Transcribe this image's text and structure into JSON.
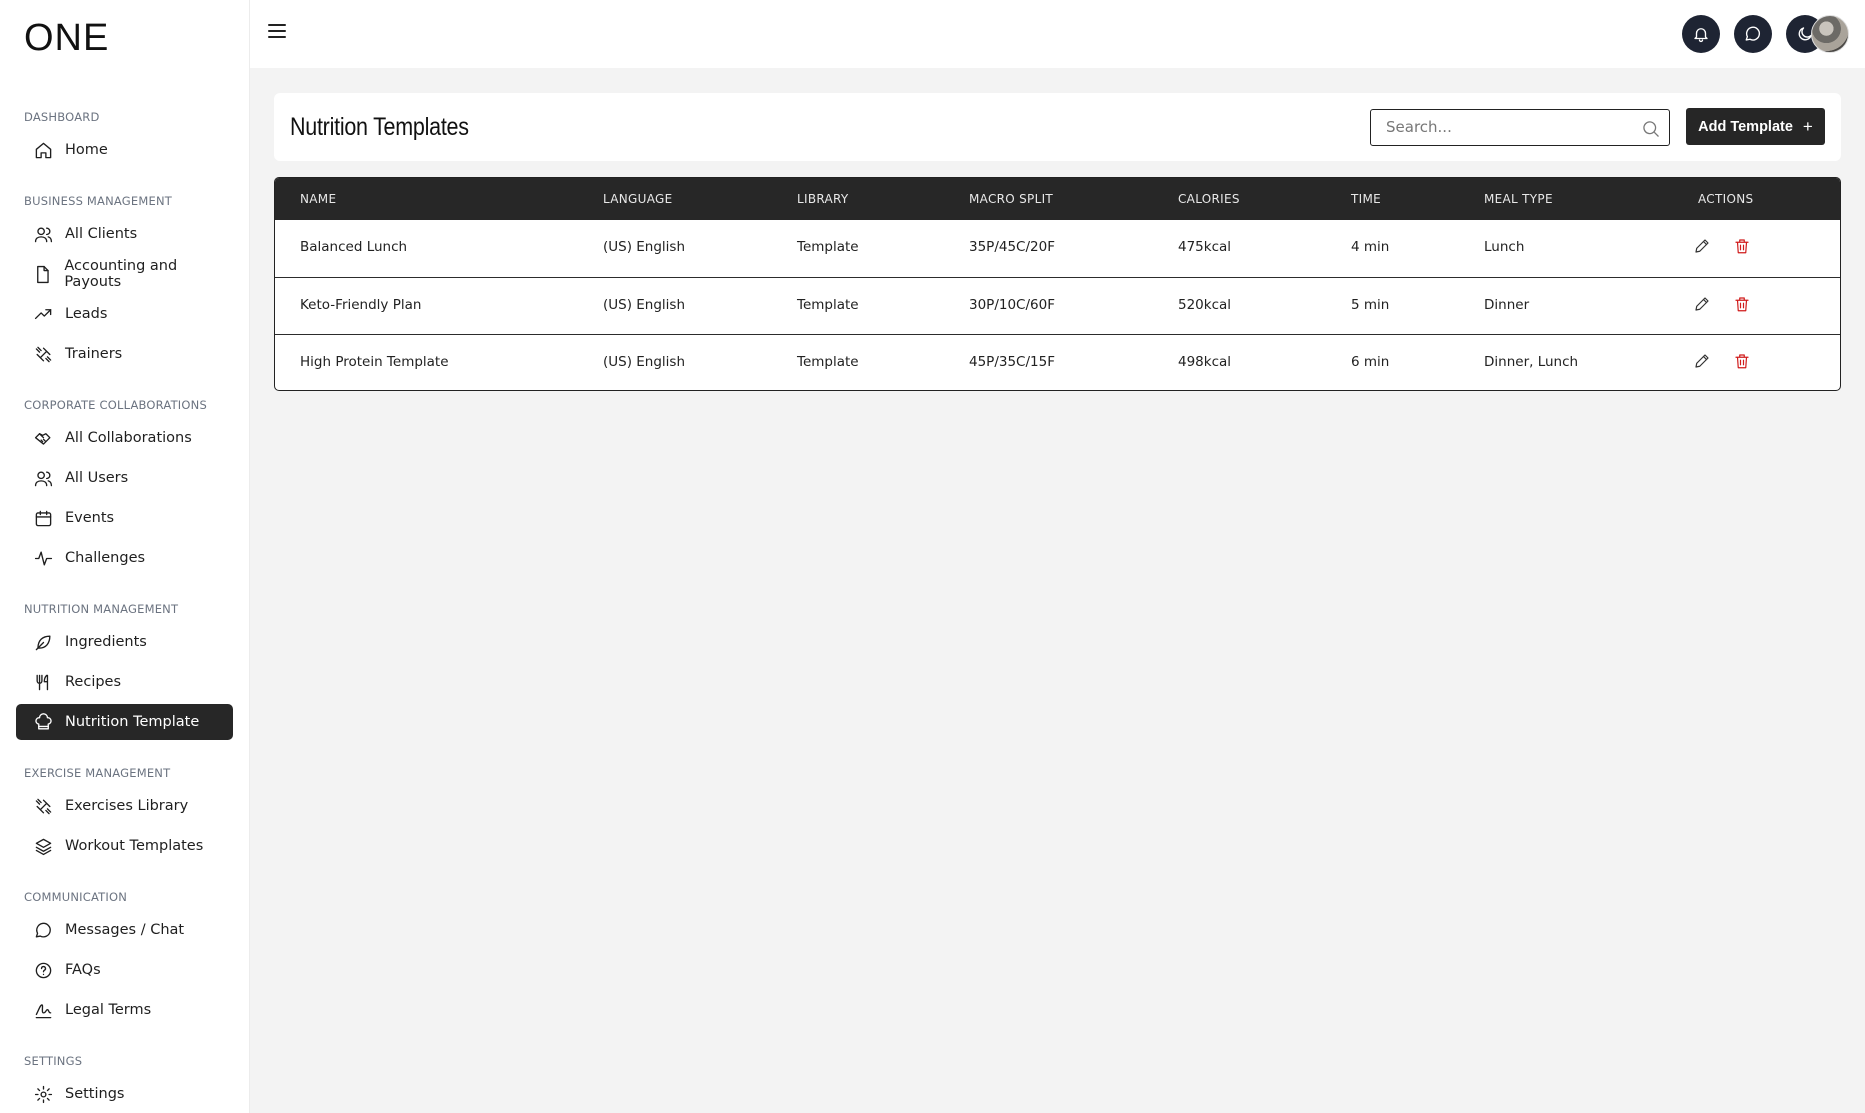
{
  "logo": "ONE",
  "sidebar": {
    "sections": [
      {
        "title": "DASHBOARD",
        "items": [
          {
            "label": "Home",
            "icon": "home-icon"
          }
        ]
      },
      {
        "title": "BUSINESS MANAGEMENT",
        "items": [
          {
            "label": "All Clients",
            "icon": "users-icon"
          },
          {
            "label": "Accounting and Payouts",
            "icon": "file-icon"
          },
          {
            "label": "Leads",
            "icon": "trending-up-icon"
          },
          {
            "label": "Trainers",
            "icon": "dumbbell-icon"
          }
        ]
      },
      {
        "title": "CORPORATE COLLABORATIONS",
        "items": [
          {
            "label": "All Collaborations",
            "icon": "handshake-icon"
          },
          {
            "label": "All Users",
            "icon": "users-icon"
          },
          {
            "label": "Events",
            "icon": "calendar-icon"
          },
          {
            "label": "Challenges",
            "icon": "activity-icon"
          }
        ]
      },
      {
        "title": "NUTRITION MANAGEMENT",
        "items": [
          {
            "label": "Ingredients",
            "icon": "leaf-icon"
          },
          {
            "label": "Recipes",
            "icon": "utensils-icon"
          },
          {
            "label": "Nutrition Template",
            "icon": "chef-hat-icon",
            "active": true
          }
        ]
      },
      {
        "title": "EXERCISE MANAGEMENT",
        "items": [
          {
            "label": "Exercises Library",
            "icon": "dumbbell-icon"
          },
          {
            "label": "Workout Templates",
            "icon": "layers-icon"
          }
        ]
      },
      {
        "title": "COMMUNICATION",
        "items": [
          {
            "label": "Messages / Chat",
            "icon": "message-circle-icon"
          },
          {
            "label": "FAQs",
            "icon": "help-circle-icon"
          },
          {
            "label": "Legal Terms",
            "icon": "signature-icon"
          }
        ]
      },
      {
        "title": "SETTINGS",
        "items": [
          {
            "label": "Settings",
            "icon": "gear-icon"
          }
        ]
      }
    ]
  },
  "topbar": {
    "buttons": [
      "bell-icon",
      "message-icon",
      "moon-icon"
    ]
  },
  "page": {
    "title": "Nutrition Templates",
    "search_placeholder": "Search...",
    "add_label": "Add Template",
    "add_icon": "+"
  },
  "table": {
    "columns": [
      "NAME",
      "LANGUAGE",
      "LIBRARY",
      "MACRO SPLIT",
      "CALORIES",
      "TIME",
      "MEAL TYPE",
      "ACTIONS"
    ],
    "rows": [
      {
        "name": "Balanced Lunch",
        "language": "(US) English",
        "library": "Template",
        "macro": "35P/45C/20F",
        "calories": "475kcal",
        "time": "4 min",
        "meal": "Lunch"
      },
      {
        "name": "Keto-Friendly Plan",
        "language": "(US) English",
        "library": "Template",
        "macro": "30P/10C/60F",
        "calories": "520kcal",
        "time": "5 min",
        "meal": "Dinner"
      },
      {
        "name": "High Protein Template",
        "language": "(US) English",
        "library": "Template",
        "macro": "45P/35C/15F",
        "calories": "498kcal",
        "time": "6 min",
        "meal": "Dinner, Lunch"
      }
    ]
  },
  "colors": {
    "sidebar_active": "#272727",
    "table_header": "#272727",
    "delete": "#d01b1b",
    "topbar_button": "#1e2433"
  }
}
